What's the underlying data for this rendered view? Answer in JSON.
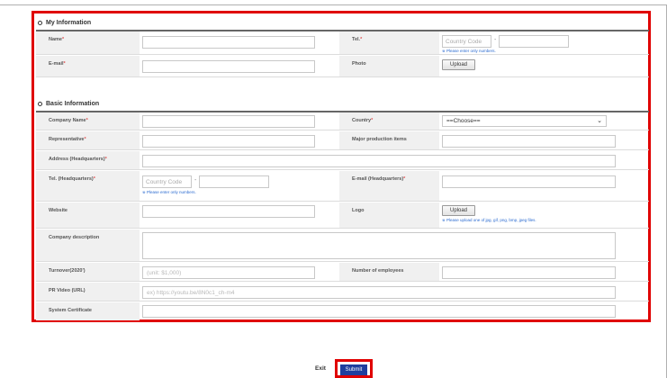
{
  "sections": {
    "my_info": "My Information",
    "basic_info": "Basic Information"
  },
  "my_info": {
    "name_label": "Name",
    "tel_label": "Tel.",
    "tel_country_placeholder": "Country Code",
    "tel_dash": "-",
    "tel_hint": "※ Please enter only numbers.",
    "email_label": "E-mail",
    "photo_label": "Photo",
    "upload": "Upload"
  },
  "basic_info": {
    "company_name_label": "Company Name",
    "country_label": "Country",
    "country_selected": "==Choose==",
    "representative_label": "Representative",
    "major_items_label": "Major production items",
    "address_label": "Address (Headquarters)",
    "tel_hq_label": "Tel. (Headquarters)",
    "tel_hq_country_placeholder": "Country Code",
    "tel_hq_dash": "-",
    "tel_hq_hint": "※ Please enter only numbers.",
    "email_hq_label": "E-mail (Headquarters)",
    "website_label": "Website",
    "logo_label": "Logo",
    "logo_upload": "Upload",
    "logo_hint": "※ Please upload one of jpg, gif, png, bmp, jpeg files.",
    "company_desc_label": "Company description",
    "turnover_label": "Turnover(2020')",
    "turnover_placeholder": "(unit: $1,000)",
    "employees_label": "Number of employees",
    "pr_video_label": "PR Video (URL)",
    "pr_video_placeholder": "ex) https://youtu.be/8N0c1_ch-m4",
    "system_cert_label": "System Certificate"
  },
  "required_mark": "*",
  "footer": {
    "exit": "Exit",
    "submit": "Submit"
  },
  "colors": {
    "highlight": "#e00000",
    "submit_bg": "#1f3e9e",
    "required": "#e05050",
    "hint": "#2a6ad0"
  }
}
